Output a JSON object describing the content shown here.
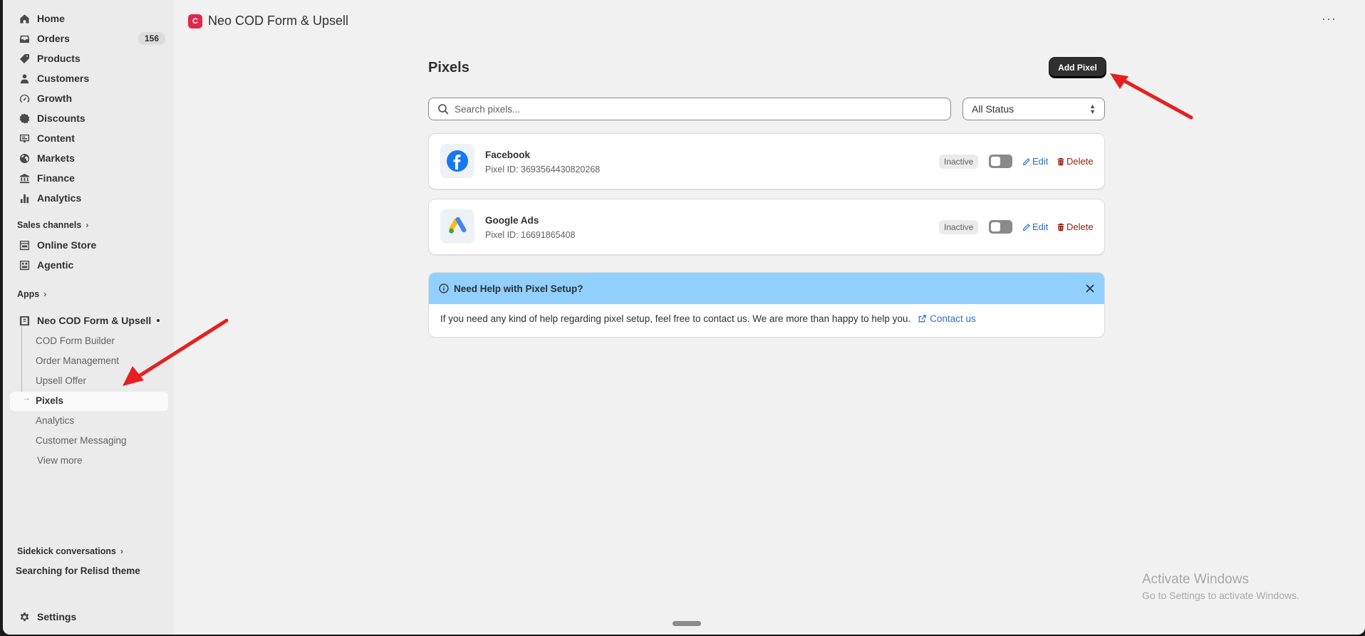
{
  "colors": {
    "accent_link": "#2c6ecb",
    "danger": "#8e1f0b",
    "banner_blue": "#91d0ff",
    "primary_button": "#303030",
    "app_brand": "#e2264d",
    "annotation_arrow": "#e62020"
  },
  "sidebar": {
    "nav": [
      {
        "label": "Home",
        "icon": "home-icon"
      },
      {
        "label": "Orders",
        "icon": "inbox-icon",
        "badge": "156"
      },
      {
        "label": "Products",
        "icon": "tag-icon"
      },
      {
        "label": "Customers",
        "icon": "person-icon"
      },
      {
        "label": "Growth",
        "icon": "gauge-icon"
      },
      {
        "label": "Discounts",
        "icon": "discount-icon"
      },
      {
        "label": "Content",
        "icon": "content-icon"
      },
      {
        "label": "Markets",
        "icon": "globe-icon"
      },
      {
        "label": "Finance",
        "icon": "bank-icon"
      },
      {
        "label": "Analytics",
        "icon": "bar-chart-icon"
      }
    ],
    "sales_channels_label": "Sales channels",
    "channels": [
      {
        "label": "Online Store",
        "icon": "store-icon"
      },
      {
        "label": "Agentic",
        "icon": "agentic-icon"
      }
    ],
    "apps_label": "Apps",
    "app": {
      "label": "Neo COD Form & Upsell",
      "icon": "app-icon"
    },
    "app_subitems": [
      "COD Form Builder",
      "Order Management",
      "Upsell Offer",
      "Pixels",
      "Analytics",
      "Customer Messaging"
    ],
    "view_more": "View more",
    "sidekick_label": "Sidekick conversations",
    "sidekick_item": "Searching for Relisd theme",
    "settings_label": "Settings"
  },
  "header": {
    "app_title": "Neo COD Form & Upsell",
    "logo_glyph": "C"
  },
  "main": {
    "page_title": "Pixels",
    "add_button": "Add Pixel",
    "search_placeholder": "Search pixels...",
    "status_filter": "All Status",
    "pixels": [
      {
        "name": "Facebook",
        "id_text": "Pixel ID: 3693564430820268",
        "status": "Inactive",
        "edit": "Edit",
        "delete": "Delete",
        "icon": "facebook-icon",
        "active": false
      },
      {
        "name": "Google Ads",
        "id_text": "Pixel ID: 16691865408",
        "status": "Inactive",
        "edit": "Edit",
        "delete": "Delete",
        "icon": "google-ads-icon",
        "active": false
      }
    ],
    "help": {
      "title": "Need Help with Pixel Setup?",
      "body": "If you need any kind of help regarding pixel setup, feel free to contact us. We are more than happy to help you.",
      "link": "Contact us"
    }
  },
  "watermark": {
    "line1": "Activate Windows",
    "line2": "Go to Settings to activate Windows."
  }
}
